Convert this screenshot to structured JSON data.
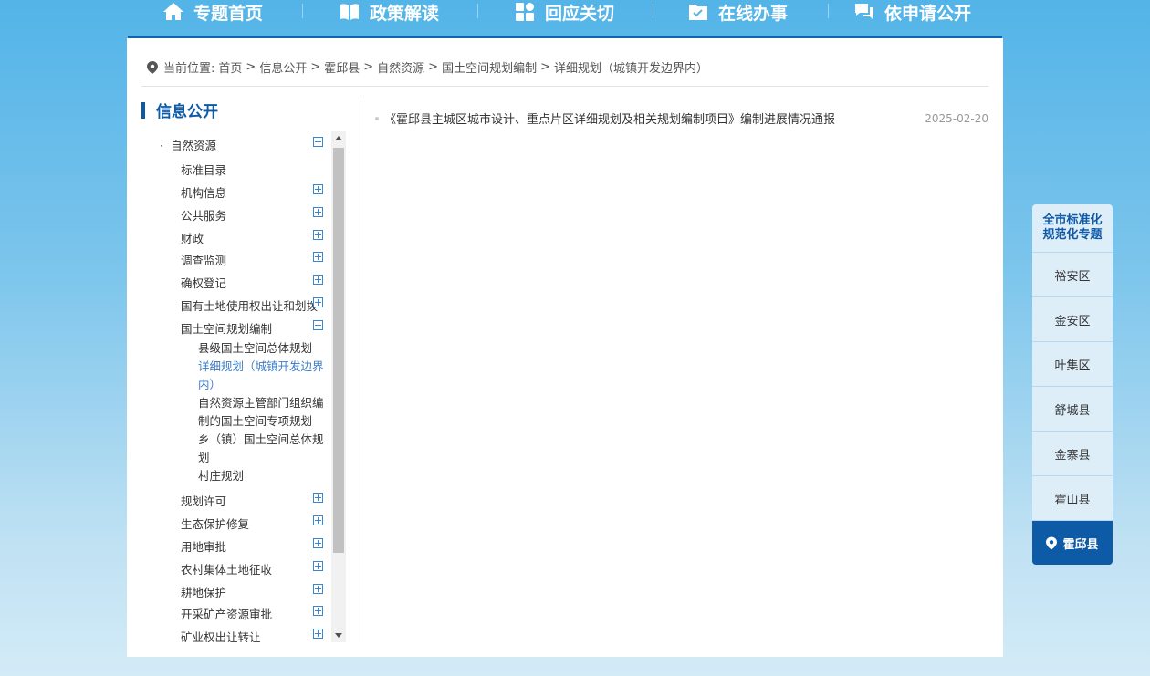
{
  "nav": [
    {
      "label": "专题首页",
      "icon": "home-icon"
    },
    {
      "label": "政策解读",
      "icon": "book-icon"
    },
    {
      "label": "回应关切",
      "icon": "grid-icon"
    },
    {
      "label": "在线办事",
      "icon": "folder-check-icon"
    },
    {
      "label": "依申请公开",
      "icon": "chat-icon"
    }
  ],
  "breadcrumb": {
    "prefix": "当前位置:",
    "items": [
      "首页",
      "信息公开",
      "霍邱县",
      "自然资源",
      "国土空间规划编制",
      "详细规划（城镇开发边界内）"
    ],
    "sep": ">"
  },
  "sidebar": {
    "title": "信息公开",
    "root": {
      "label": "自然资源",
      "bullet": "·"
    },
    "items": [
      {
        "label": "标准目录"
      },
      {
        "label": "机构信息"
      },
      {
        "label": "公共服务"
      },
      {
        "label": "财政"
      },
      {
        "label": "调查监测"
      },
      {
        "label": "确权登记"
      },
      {
        "label": "国有土地使用权出让和划拨"
      },
      {
        "label": "国土空间规划编制"
      },
      {
        "label": "县级国土空间总体规划"
      },
      {
        "label": "详细规划（城镇开发边界内）"
      },
      {
        "label": "自然资源主管部门组织编制的国土空间专项规划"
      },
      {
        "label": "乡（镇）国土空间总体规划"
      },
      {
        "label": "村庄规划"
      },
      {
        "label": "规划许可"
      },
      {
        "label": "生态保护修复"
      },
      {
        "label": "用地审批"
      },
      {
        "label": "农村集体土地征收"
      },
      {
        "label": "耕地保护"
      },
      {
        "label": "开采矿产资源审批"
      },
      {
        "label": "矿业权出让转让"
      }
    ]
  },
  "article": {
    "title": "《霍邱县主城区城市设计、重点片区详细规划及相关规划编制项目》编制进展情况通报",
    "date": "2025-02-20"
  },
  "right_nav": {
    "header": "全市标准化规范化专题",
    "header_line1": "全市标准化",
    "header_line2": "规范化专题",
    "items": [
      "裕安区",
      "金安区",
      "叶集区",
      "舒城县",
      "金寨县",
      "霍山县"
    ],
    "active": "霍邱县"
  }
}
